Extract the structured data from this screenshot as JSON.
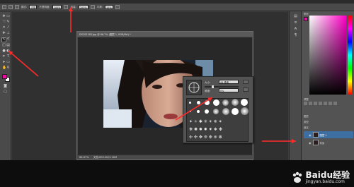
{
  "options_bar": {
    "mode_label": "模式:",
    "mode_value": "正常",
    "opacity_label": "不透明度:",
    "opacity_value": "100%",
    "flow_label": "流量:",
    "flow_value": "100%",
    "smoothing_label": "平滑:",
    "smoothing_value": "10%"
  },
  "document": {
    "title": "DSC02183.jpg @ 66.7% (图层 1, RGB/8#) *",
    "zoom": "66.67%",
    "doc_info": "文档:895.0K/3.18M"
  },
  "brush_panel": {
    "size_label": "大小:",
    "size_value": "44 像素",
    "hardness_label": "硬度:",
    "hardness_value": "0%"
  },
  "right_panels": {
    "color_tab": "颜色",
    "adjustments_tab": "调整",
    "layers_tab": "图层",
    "kind_label": "类型",
    "lock_label": "锁定:",
    "layer_1": "图层 1",
    "layer_bg": "背景"
  },
  "colors": {
    "foreground": "#e60fa0",
    "background": "#ffffff",
    "annotation_red": "#ff2a2a"
  },
  "watermark": {
    "site": "jingyan.baidu.com",
    "brand": "Baidu经验"
  }
}
